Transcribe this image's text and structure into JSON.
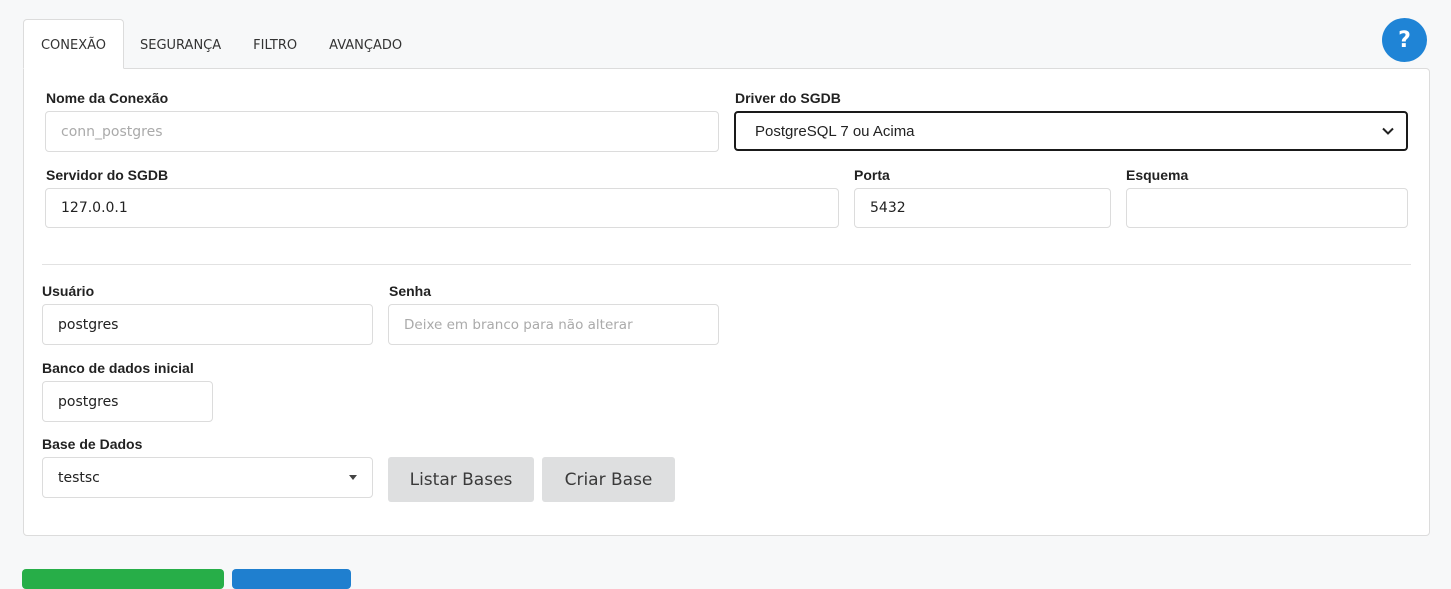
{
  "tabs": [
    {
      "label": "CONEXÃO",
      "active": true
    },
    {
      "label": "SEGURANÇA",
      "active": false
    },
    {
      "label": "FILTRO",
      "active": false
    },
    {
      "label": "AVANÇADO",
      "active": false
    }
  ],
  "help": {
    "label": "?",
    "icon": "question-icon",
    "color": "#1f84d6"
  },
  "form": {
    "connection_name": {
      "label": "Nome da Conexão",
      "placeholder": "conn_postgres",
      "value": ""
    },
    "driver": {
      "label": "Driver do SGDB",
      "value": "PostgreSQL 7 ou Acima"
    },
    "server": {
      "label": "Servidor do SGDB",
      "value": "127.0.0.1"
    },
    "port": {
      "label": "Porta",
      "value": "5432"
    },
    "schema": {
      "label": "Esquema",
      "value": ""
    },
    "user": {
      "label": "Usuário",
      "value": "postgres"
    },
    "password": {
      "label": "Senha",
      "placeholder": "Deixe em branco para não alterar",
      "value": ""
    },
    "initial_db": {
      "label": "Banco de dados inicial",
      "value": "postgres"
    },
    "database": {
      "label": "Base de Dados",
      "value": "testsc"
    }
  },
  "buttons": {
    "list_bases": "Listar Bases",
    "create_base": "Criar Base"
  },
  "colors": {
    "primary_blue": "#1f84d6",
    "green": "#27ae48",
    "blue_button": "#1f7fcf",
    "grey_button": "#dedfe0"
  }
}
